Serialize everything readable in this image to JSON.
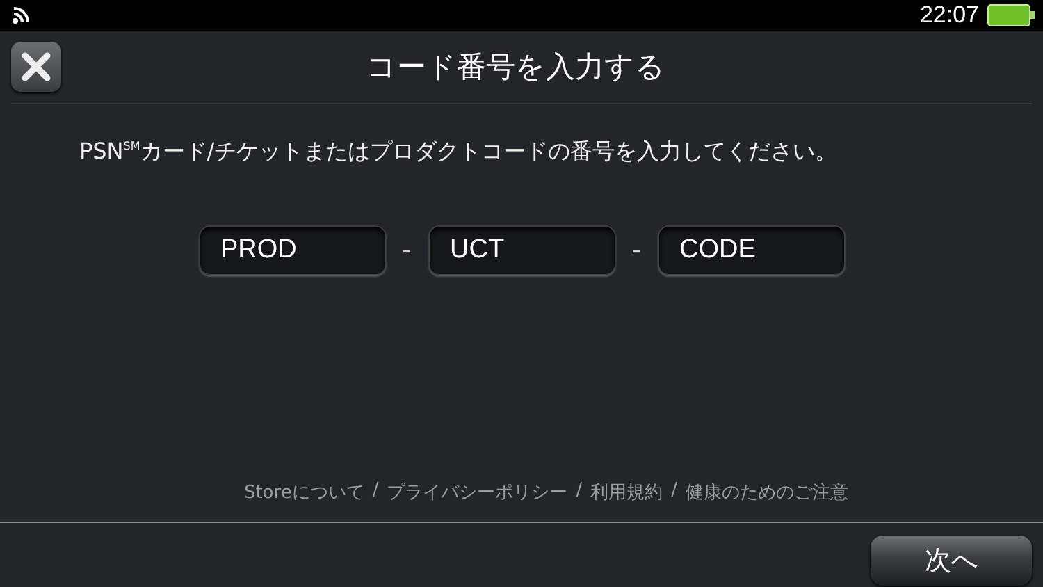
{
  "status_bar": {
    "time": "22:07"
  },
  "header": {
    "title": "コード番号を入力する"
  },
  "instruction": "PSN$^{SM}$カード/チケットまたはプロダクトコードの番号を入力してください。",
  "code_fields": [
    {
      "value": "PROD"
    },
    {
      "value": "UCT"
    },
    {
      "value": "CODE"
    }
  ],
  "code_separator": "-",
  "footer_links": [
    "Storeについて",
    "プライバシーポリシー",
    "利用規約",
    "健康のためのご注意"
  ],
  "link_separator": "/",
  "next_button": "次へ"
}
